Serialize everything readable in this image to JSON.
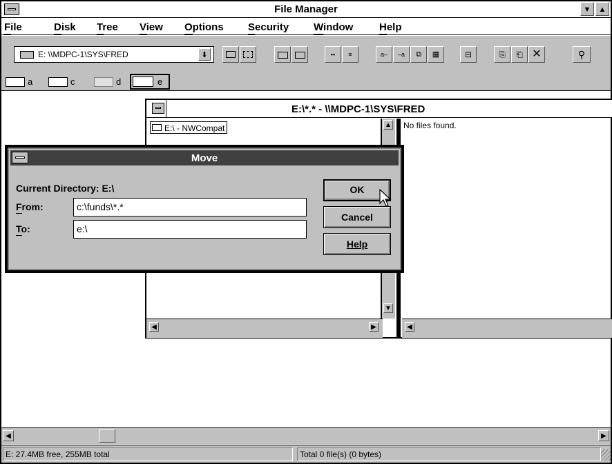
{
  "window": {
    "title": "File Manager"
  },
  "menu": [
    "File",
    "Disk",
    "Tree",
    "View",
    "Options",
    "Security",
    "Window",
    "Help"
  ],
  "toolbar": {
    "drive_path": "E: \\\\MDPC-1\\SYS\\FRED"
  },
  "drives": [
    "a",
    "c",
    "d",
    "e"
  ],
  "child": {
    "title": "E:\\*.* - \\\\MDPC-1\\SYS\\FRED",
    "tree_item": "E:\\ - NWCompat",
    "files_message": "No files found."
  },
  "dialog": {
    "title": "Move",
    "current_directory": "Current Directory: E:\\",
    "from_label": "From:",
    "from_value": "c:\\funds\\*.*",
    "to_label": "To:",
    "to_value": "e:\\",
    "ok_label": "OK",
    "cancel_label": "Cancel",
    "help_label": "Help"
  },
  "status": {
    "left": "E: 27.4MB free,  255MB total",
    "right": "Total 0 file(s) (0 bytes)"
  },
  "colors": {
    "title_active": "#000000",
    "title_inactive": "#ffffff",
    "dialog_title": "#404040",
    "face": "#c0c0c0"
  }
}
